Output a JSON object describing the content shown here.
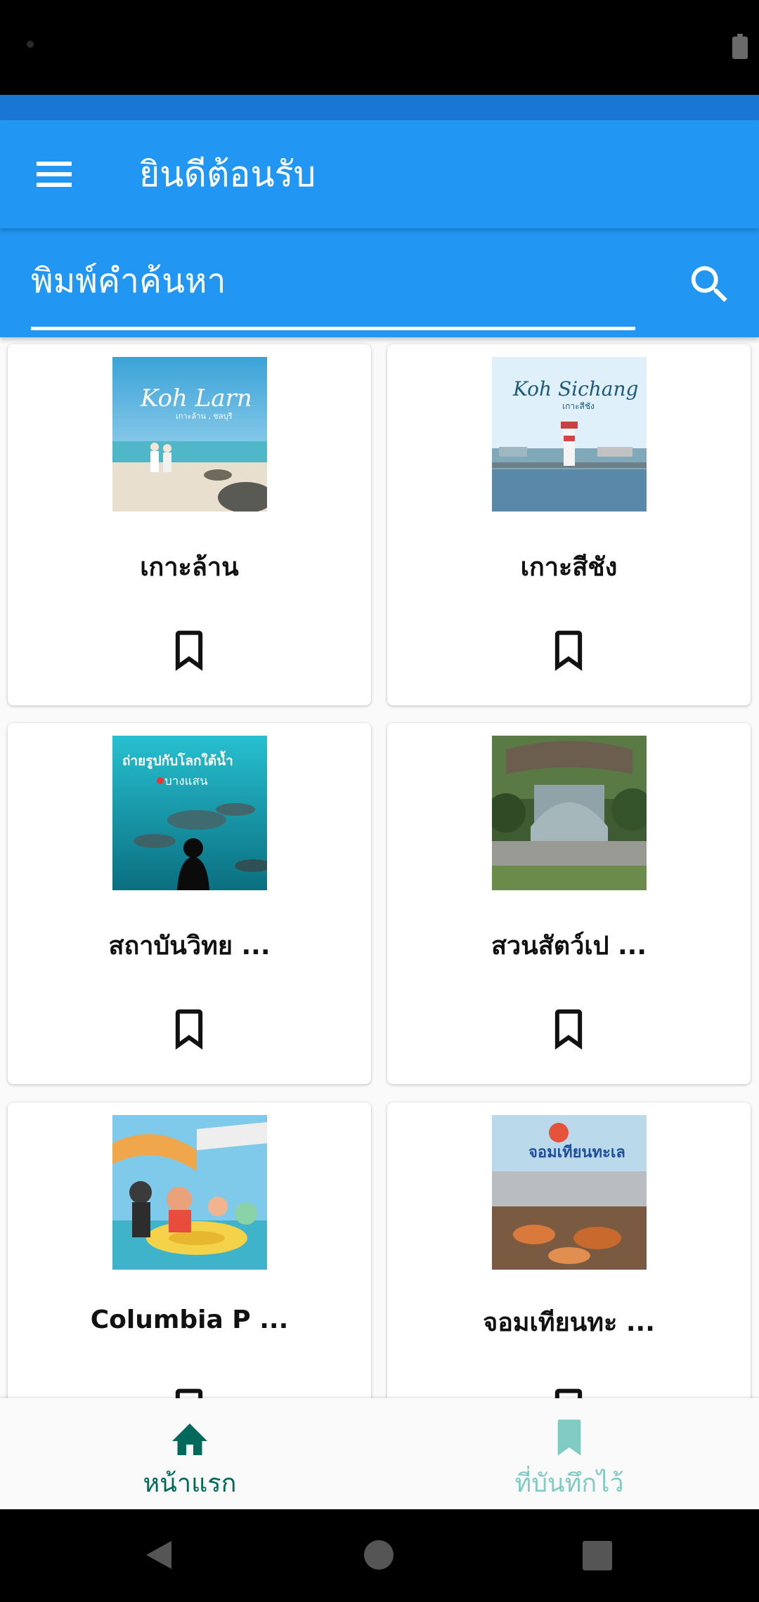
{
  "app_title": "ยินดีต้อนรับ",
  "search": {
    "placeholder": "พิมพ์คำค้นหา"
  },
  "places": [
    {
      "title": "เกาะล้าน",
      "image": "koh-larn-beach-photo",
      "image_caption": "Koh Larn",
      "image_subcaption": "เกาะล้าน , ชลบุรี"
    },
    {
      "title": "เกาะสีชัง",
      "image": "koh-sichang-lighthouse-photo",
      "image_caption": "Koh Sichang",
      "image_subcaption": "เกาะสีชัง"
    },
    {
      "title": "สถาบันวิทย ...",
      "image": "underwater-aquarium-photo",
      "image_caption": "ถ่ายรูปกับโลกใต้น้ำ",
      "image_subcaption": "บางแสน"
    },
    {
      "title": "สวนสัตว์เป ...",
      "image": "zoo-entrance-gate-photo",
      "image_caption": "",
      "image_subcaption": ""
    },
    {
      "title": "Columbia P ...",
      "image": "water-park-cartoon-photo",
      "image_caption": "",
      "image_subcaption": ""
    },
    {
      "title": "จอมเทียนทะ ...",
      "image": "seafood-market-photo",
      "image_caption": "จอมเทียนทะเล",
      "image_subcaption": ""
    }
  ],
  "bottom_nav": [
    {
      "label": "หน้าแรก",
      "icon": "home-icon",
      "active": true
    },
    {
      "label": "ที่บันทึกไว้",
      "icon": "bookmark-filled-icon",
      "active": false
    }
  ],
  "colors": {
    "primary": "#2196f3",
    "primary_dark": "#1976d2",
    "nav_active": "#00695c",
    "nav_inactive": "#80cbc4"
  }
}
